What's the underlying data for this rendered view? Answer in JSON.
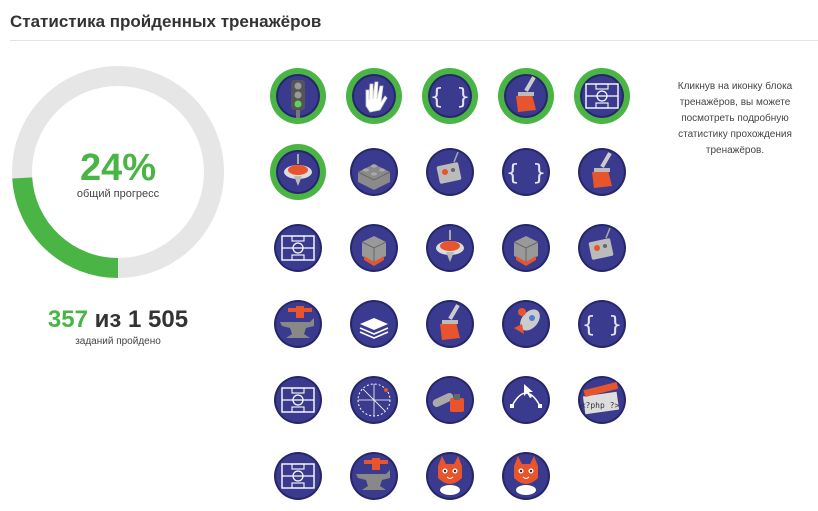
{
  "page": {
    "title": "Статистика пройденных тренажёров"
  },
  "progress": {
    "percent_label": "24%",
    "percent_value": 24,
    "caption": "общий прогресс",
    "done": "357",
    "separator": "из",
    "total": "1 505",
    "tasks_caption": "заданий пройдено",
    "colors": {
      "done": "#4ab544",
      "track": "#e6e6e6"
    }
  },
  "help": {
    "text": "Кликнув на иконку блока тренажёров, вы можете посмотреть подробную статистику прохождения тренажёров."
  },
  "colors": {
    "badge": "#3a3a8e",
    "badge_dark": "#26266a",
    "completed_ring": "#4ab544",
    "accent": "#e8542c"
  },
  "trainers": [
    {
      "icon": "traffic-light-icon",
      "completed": true
    },
    {
      "icon": "hand-icon",
      "completed": true
    },
    {
      "icon": "curly-braces-icon",
      "completed": true
    },
    {
      "icon": "paint-brush-icon",
      "completed": true
    },
    {
      "icon": "football-field-icon",
      "completed": true
    },
    {
      "icon": "spinning-top-icon",
      "completed": true
    },
    {
      "icon": "lego-brick-icon",
      "completed": false
    },
    {
      "icon": "robot-box-icon",
      "completed": false
    },
    {
      "icon": "curly-braces-icon",
      "completed": false
    },
    {
      "icon": "paint-brush-icon",
      "completed": false
    },
    {
      "icon": "football-field-icon",
      "completed": false
    },
    {
      "icon": "rubiks-cube-icon",
      "completed": false
    },
    {
      "icon": "spinning-top-icon",
      "completed": false
    },
    {
      "icon": "rubiks-cube-icon",
      "completed": false
    },
    {
      "icon": "robot-box-icon",
      "completed": false
    },
    {
      "icon": "anvil-icon",
      "completed": false
    },
    {
      "icon": "layers-stack-icon",
      "completed": false
    },
    {
      "icon": "paint-brush-icon",
      "completed": false
    },
    {
      "icon": "rocket-icon",
      "completed": false
    },
    {
      "icon": "curly-braces-icon",
      "completed": false
    },
    {
      "icon": "football-field-icon",
      "completed": false
    },
    {
      "icon": "geometry-circle-icon",
      "completed": false
    },
    {
      "icon": "chainsaw-icon",
      "completed": false
    },
    {
      "icon": "vector-path-icon",
      "completed": false
    },
    {
      "icon": "php-clapperboard-icon",
      "completed": false
    },
    {
      "icon": "football-field-icon",
      "completed": false
    },
    {
      "icon": "anvil-icon",
      "completed": false
    },
    {
      "icon": "cat-icon",
      "completed": false
    },
    {
      "icon": "cat-icon",
      "completed": false
    }
  ]
}
